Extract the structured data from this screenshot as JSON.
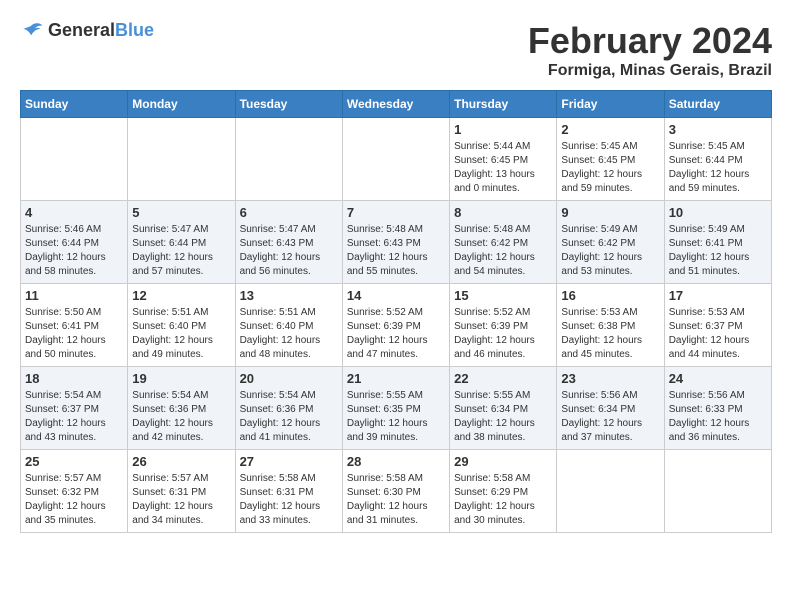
{
  "header": {
    "logo_general": "General",
    "logo_blue": "Blue",
    "month_title": "February 2024",
    "location": "Formiga, Minas Gerais, Brazil"
  },
  "weekdays": [
    "Sunday",
    "Monday",
    "Tuesday",
    "Wednesday",
    "Thursday",
    "Friday",
    "Saturday"
  ],
  "weeks": [
    [
      {
        "day": "",
        "info": ""
      },
      {
        "day": "",
        "info": ""
      },
      {
        "day": "",
        "info": ""
      },
      {
        "day": "",
        "info": ""
      },
      {
        "day": "1",
        "info": "Sunrise: 5:44 AM\nSunset: 6:45 PM\nDaylight: 13 hours\nand 0 minutes."
      },
      {
        "day": "2",
        "info": "Sunrise: 5:45 AM\nSunset: 6:45 PM\nDaylight: 12 hours\nand 59 minutes."
      },
      {
        "day": "3",
        "info": "Sunrise: 5:45 AM\nSunset: 6:44 PM\nDaylight: 12 hours\nand 59 minutes."
      }
    ],
    [
      {
        "day": "4",
        "info": "Sunrise: 5:46 AM\nSunset: 6:44 PM\nDaylight: 12 hours\nand 58 minutes."
      },
      {
        "day": "5",
        "info": "Sunrise: 5:47 AM\nSunset: 6:44 PM\nDaylight: 12 hours\nand 57 minutes."
      },
      {
        "day": "6",
        "info": "Sunrise: 5:47 AM\nSunset: 6:43 PM\nDaylight: 12 hours\nand 56 minutes."
      },
      {
        "day": "7",
        "info": "Sunrise: 5:48 AM\nSunset: 6:43 PM\nDaylight: 12 hours\nand 55 minutes."
      },
      {
        "day": "8",
        "info": "Sunrise: 5:48 AM\nSunset: 6:42 PM\nDaylight: 12 hours\nand 54 minutes."
      },
      {
        "day": "9",
        "info": "Sunrise: 5:49 AM\nSunset: 6:42 PM\nDaylight: 12 hours\nand 53 minutes."
      },
      {
        "day": "10",
        "info": "Sunrise: 5:49 AM\nSunset: 6:41 PM\nDaylight: 12 hours\nand 51 minutes."
      }
    ],
    [
      {
        "day": "11",
        "info": "Sunrise: 5:50 AM\nSunset: 6:41 PM\nDaylight: 12 hours\nand 50 minutes."
      },
      {
        "day": "12",
        "info": "Sunrise: 5:51 AM\nSunset: 6:40 PM\nDaylight: 12 hours\nand 49 minutes."
      },
      {
        "day": "13",
        "info": "Sunrise: 5:51 AM\nSunset: 6:40 PM\nDaylight: 12 hours\nand 48 minutes."
      },
      {
        "day": "14",
        "info": "Sunrise: 5:52 AM\nSunset: 6:39 PM\nDaylight: 12 hours\nand 47 minutes."
      },
      {
        "day": "15",
        "info": "Sunrise: 5:52 AM\nSunset: 6:39 PM\nDaylight: 12 hours\nand 46 minutes."
      },
      {
        "day": "16",
        "info": "Sunrise: 5:53 AM\nSunset: 6:38 PM\nDaylight: 12 hours\nand 45 minutes."
      },
      {
        "day": "17",
        "info": "Sunrise: 5:53 AM\nSunset: 6:37 PM\nDaylight: 12 hours\nand 44 minutes."
      }
    ],
    [
      {
        "day": "18",
        "info": "Sunrise: 5:54 AM\nSunset: 6:37 PM\nDaylight: 12 hours\nand 43 minutes."
      },
      {
        "day": "19",
        "info": "Sunrise: 5:54 AM\nSunset: 6:36 PM\nDaylight: 12 hours\nand 42 minutes."
      },
      {
        "day": "20",
        "info": "Sunrise: 5:54 AM\nSunset: 6:36 PM\nDaylight: 12 hours\nand 41 minutes."
      },
      {
        "day": "21",
        "info": "Sunrise: 5:55 AM\nSunset: 6:35 PM\nDaylight: 12 hours\nand 39 minutes."
      },
      {
        "day": "22",
        "info": "Sunrise: 5:55 AM\nSunset: 6:34 PM\nDaylight: 12 hours\nand 38 minutes."
      },
      {
        "day": "23",
        "info": "Sunrise: 5:56 AM\nSunset: 6:34 PM\nDaylight: 12 hours\nand 37 minutes."
      },
      {
        "day": "24",
        "info": "Sunrise: 5:56 AM\nSunset: 6:33 PM\nDaylight: 12 hours\nand 36 minutes."
      }
    ],
    [
      {
        "day": "25",
        "info": "Sunrise: 5:57 AM\nSunset: 6:32 PM\nDaylight: 12 hours\nand 35 minutes."
      },
      {
        "day": "26",
        "info": "Sunrise: 5:57 AM\nSunset: 6:31 PM\nDaylight: 12 hours\nand 34 minutes."
      },
      {
        "day": "27",
        "info": "Sunrise: 5:58 AM\nSunset: 6:31 PM\nDaylight: 12 hours\nand 33 minutes."
      },
      {
        "day": "28",
        "info": "Sunrise: 5:58 AM\nSunset: 6:30 PM\nDaylight: 12 hours\nand 31 minutes."
      },
      {
        "day": "29",
        "info": "Sunrise: 5:58 AM\nSunset: 6:29 PM\nDaylight: 12 hours\nand 30 minutes."
      },
      {
        "day": "",
        "info": ""
      },
      {
        "day": "",
        "info": ""
      }
    ]
  ]
}
